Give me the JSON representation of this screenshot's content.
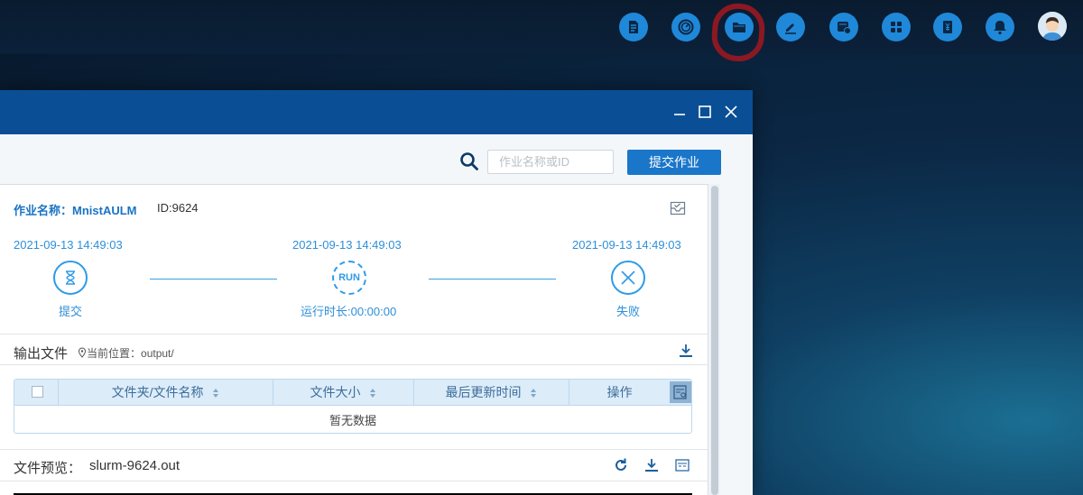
{
  "topbar": {
    "icons": [
      "document-edit-icon",
      "speedometer-icon",
      "folder-icon",
      "edit-icon",
      "schedule-icon",
      "apps-grid-icon",
      "billing-yen-icon",
      "bell-icon"
    ],
    "accent": "#1f88d9",
    "highlight_color": "#8b1822"
  },
  "search": {
    "placeholder": "作业名称或ID"
  },
  "toolbar": {
    "submit_label": "提交作业"
  },
  "job": {
    "name_label": "作业名称：",
    "name_value": "MnistAULM",
    "id_text": "ID:9624"
  },
  "steps": [
    {
      "time": "2021-09-13 14:49:03",
      "label": "提交",
      "icon": "hourglass-icon"
    },
    {
      "time": "2021-09-13 14:49:03",
      "label": "运行时长:00:00:00",
      "icon_text": "RUN"
    },
    {
      "time": "2021-09-13 14:49:03",
      "label": "失败",
      "icon": "x-circle-icon"
    }
  ],
  "output": {
    "title": "输出文件",
    "location_label": "当前位置：",
    "location_value": "output/"
  },
  "table": {
    "headers": [
      "文件夹/文件名称",
      "文件大小",
      "最后更新时间",
      "操作"
    ],
    "empty_text": "暂无数据"
  },
  "preview": {
    "label": "文件预览：",
    "file": "slurm-9624.out"
  }
}
